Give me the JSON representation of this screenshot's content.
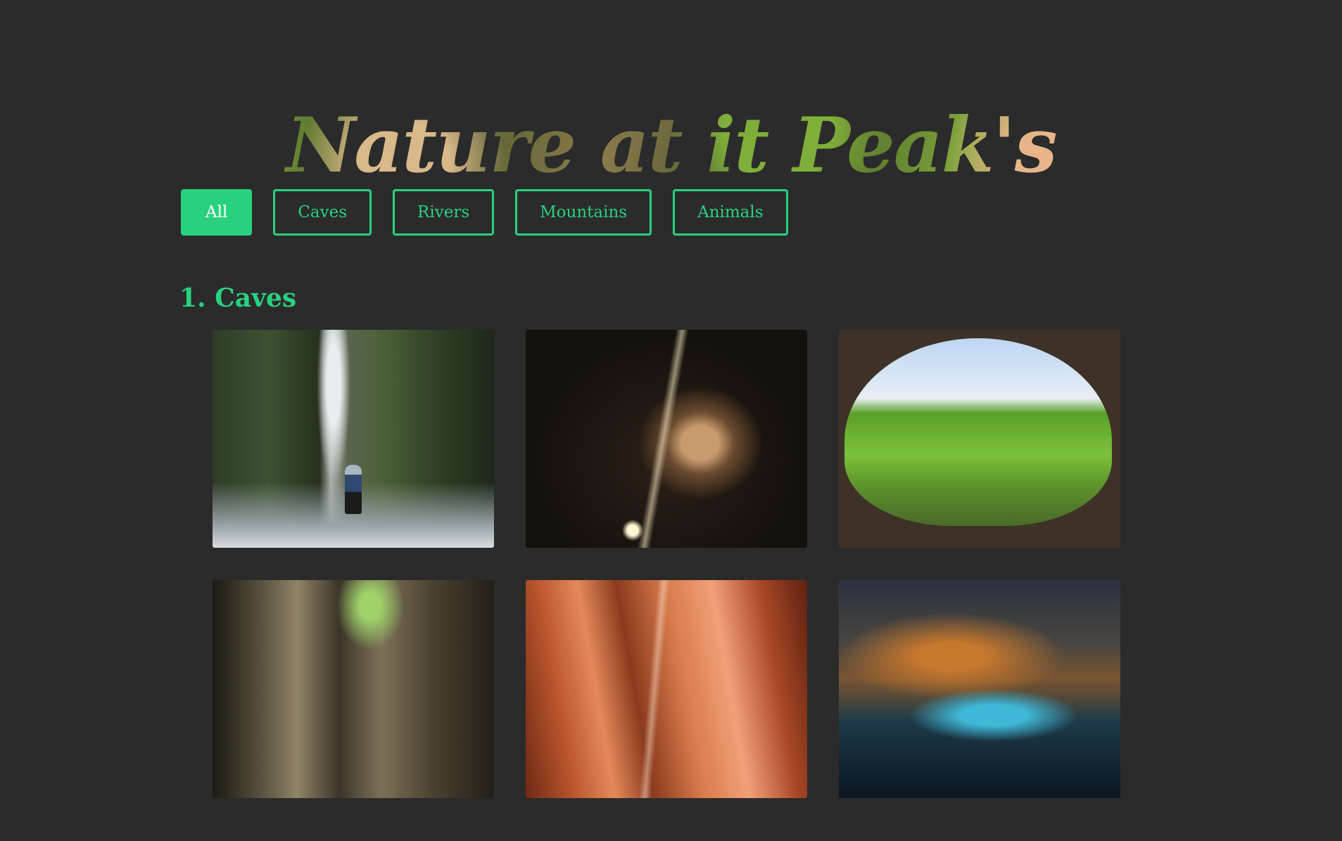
{
  "header": {
    "title": "Nature at it Peak's"
  },
  "filters": [
    {
      "label": "All",
      "active": true
    },
    {
      "label": "Caves",
      "active": false
    },
    {
      "label": "Rivers",
      "active": false
    },
    {
      "label": "Mountains",
      "active": false
    },
    {
      "label": "Animals",
      "active": false
    }
  ],
  "sections": [
    {
      "heading": "1. Caves",
      "photos": [
        {
          "subject": "narrow mossy canyon with hiker"
        },
        {
          "subject": "dark cave with light beam"
        },
        {
          "subject": "cave opening overlooking green hills"
        },
        {
          "subject": "cave walls with green light from above"
        },
        {
          "subject": "red slot canyon with light beam"
        },
        {
          "subject": "cave with blue water pool"
        }
      ]
    }
  ],
  "colors": {
    "background": "#2b2b2b",
    "accent": "#29d17f",
    "active_button_text": "#ffffff"
  }
}
